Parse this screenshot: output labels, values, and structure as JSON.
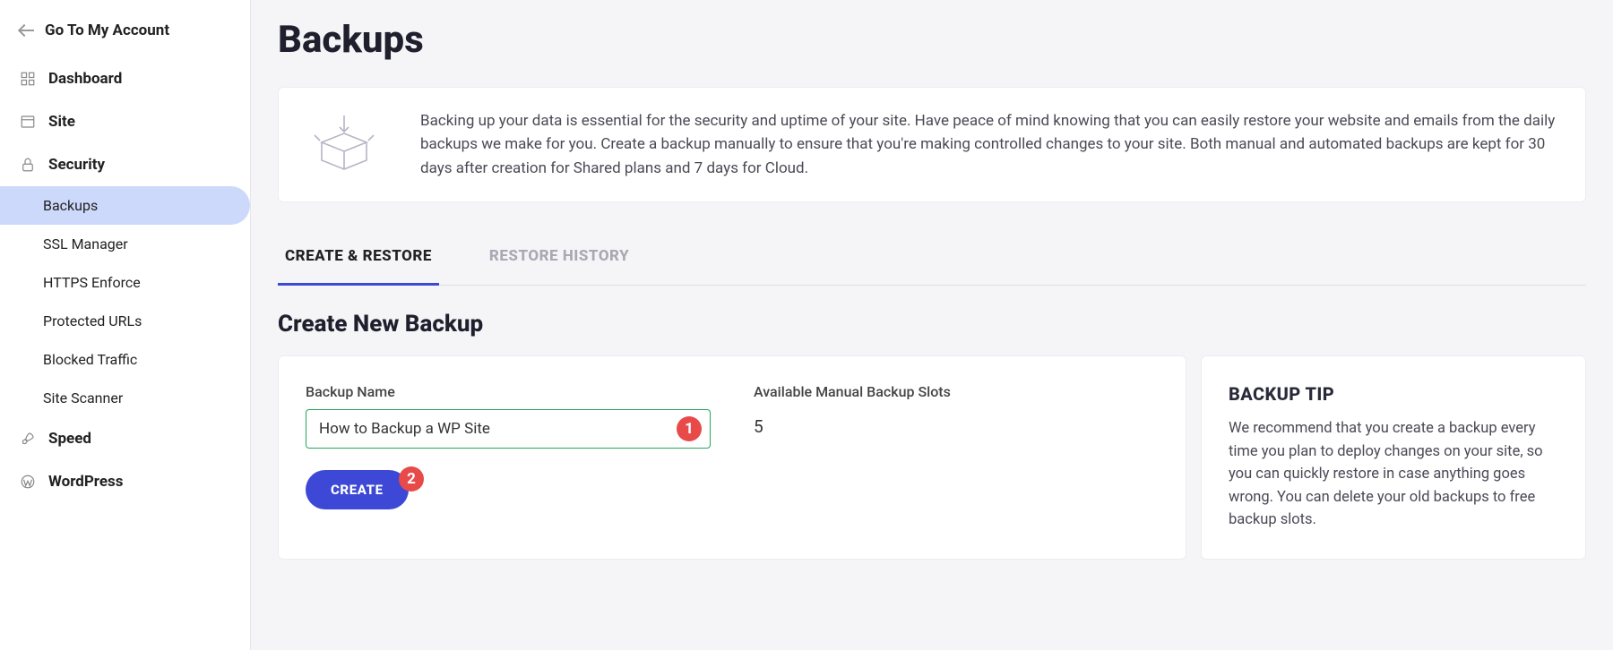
{
  "sidebar": {
    "account_link": "Go To My Account",
    "items": [
      {
        "label": "Dashboard"
      },
      {
        "label": "Site"
      },
      {
        "label": "Security",
        "children": [
          "Backups",
          "SSL Manager",
          "HTTPS Enforce",
          "Protected URLs",
          "Blocked Traffic",
          "Site Scanner"
        ]
      },
      {
        "label": "Speed"
      },
      {
        "label": "WordPress"
      }
    ]
  },
  "page": {
    "title": "Backups",
    "intro": "Backing up your data is essential for the security and uptime of your site. Have peace of mind knowing that you can easily restore your website and emails from the daily backups we make for you. Create a backup manually to ensure that you're making controlled changes to your site. Both manual and automated backups are kept for 30 days after creation for Shared plans and 7 days for Cloud."
  },
  "tabs": {
    "create_restore": "CREATE & RESTORE",
    "restore_history": "RESTORE HISTORY"
  },
  "section": {
    "title": "Create New Backup",
    "backup_name_label": "Backup Name",
    "backup_name_value": "How to Backup a WP Site",
    "slots_label": "Available Manual Backup Slots",
    "slots_value": "5",
    "create_button": "CREATE",
    "tip_title": "BACKUP TIP",
    "tip_text": "We recommend that you create a backup every time you plan to deploy changes on your site, so you can quickly restore in case anything goes wrong. You can delete your old backups to free backup slots."
  },
  "annotations": {
    "badge1": "1",
    "badge2": "2"
  }
}
